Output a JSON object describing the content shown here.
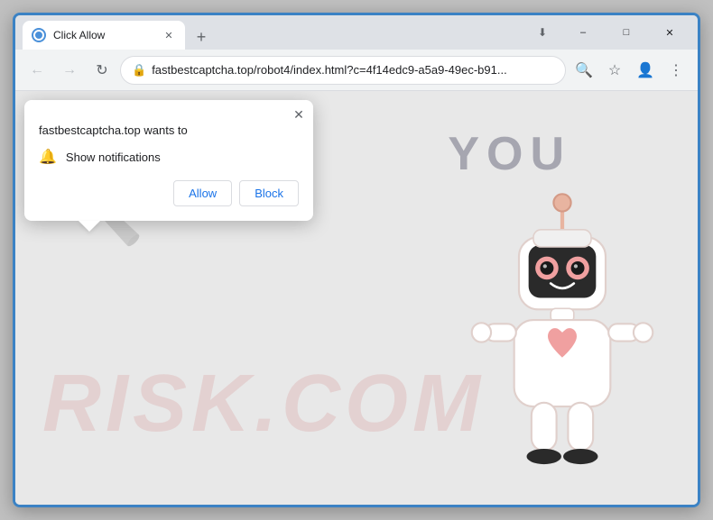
{
  "browser": {
    "tab": {
      "title": "Click Allow",
      "favicon": "globe"
    },
    "new_tab_icon": "+",
    "window_controls": {
      "minimize": "–",
      "maximize": "□",
      "close": "✕"
    },
    "toolbar": {
      "back": "←",
      "forward": "→",
      "refresh": "↻",
      "url": "fastbestcaptcha.top/robot4/index.html?c=4f14edc9-a5a9-49ec-b91...",
      "lock": "🔒",
      "search_icon": "🔍",
      "bookmark_icon": "☆",
      "profile_icon": "👤",
      "menu_icon": "⋮",
      "download_icon": "⬇"
    }
  },
  "page": {
    "watermark_text": "RISK.COM",
    "you_text": "YOU",
    "bg_color": "#e8e8e8"
  },
  "popup": {
    "close_button": "✕",
    "title": "fastbestcaptcha.top wants to",
    "permission_label": "Show notifications",
    "allow_button": "Allow",
    "block_button": "Block",
    "bell_icon": "🔔"
  }
}
